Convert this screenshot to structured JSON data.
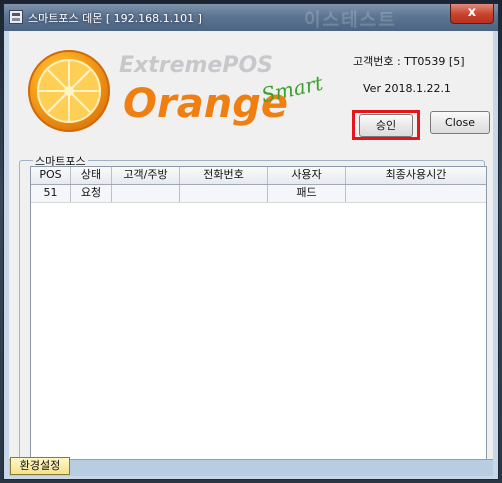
{
  "window": {
    "title": "스마트포스 데몬 [ 192.168.1.101 ]",
    "title_backdrop": "이스테스트",
    "close_glyph": "x"
  },
  "logo": {
    "line1": "ExtremePOS",
    "line2": "Orange",
    "line3": "Smart"
  },
  "info": {
    "customer_no": "고객번호 : TT0539 [5]",
    "version": "Ver 2018.1.22.1"
  },
  "buttons": {
    "approve": "승인",
    "close": "Close"
  },
  "group": {
    "label": "스마트포스"
  },
  "table": {
    "columns": [
      "POS",
      "상태",
      "고객/주방",
      "전화번호",
      "사용자",
      "최종사용시간"
    ],
    "rows": [
      [
        "51",
        "요청",
        "",
        "",
        "패드",
        ""
      ]
    ]
  },
  "statusbar": {
    "settings": "환경설정"
  },
  "colors": {
    "accent_orange": "#f07f12",
    "smart_green": "#3aa12e",
    "highlight_red": "#e8141b"
  }
}
